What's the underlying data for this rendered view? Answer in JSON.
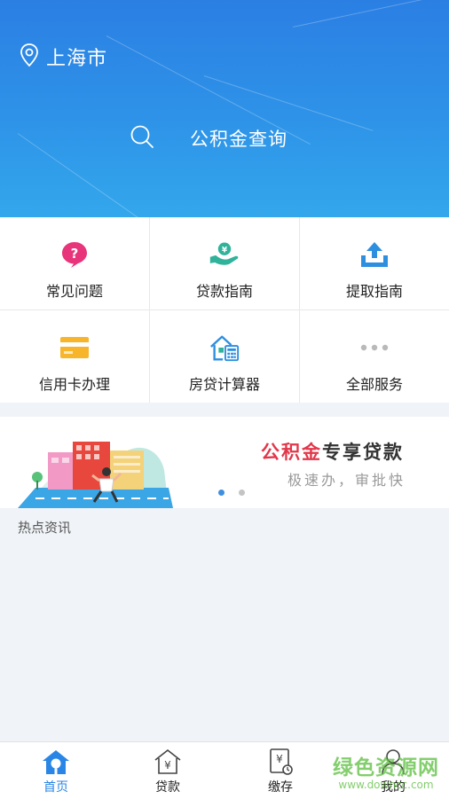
{
  "header": {
    "location": "上海市",
    "search_label": "公积金查询"
  },
  "services": [
    {
      "label": "常见问题",
      "icon": "question-bubble-icon"
    },
    {
      "label": "贷款指南",
      "icon": "money-hand-icon"
    },
    {
      "label": "提取指南",
      "icon": "upload-tray-icon"
    },
    {
      "label": "信用卡办理",
      "icon": "credit-card-icon"
    },
    {
      "label": "房贷计算器",
      "icon": "house-calculator-icon"
    },
    {
      "label": "全部服务",
      "icon": "more-dots-icon"
    }
  ],
  "banner": {
    "title_red": "公积金",
    "title_dark": "专享贷款",
    "subtitle": "极速办，审批快",
    "active_page": 1,
    "page_count": 2
  },
  "news": {
    "title": "热点资讯"
  },
  "tabs": [
    {
      "label": "首页",
      "icon": "home-icon",
      "active": true
    },
    {
      "label": "贷款",
      "icon": "loan-house-icon",
      "active": false
    },
    {
      "label": "缴存",
      "icon": "deposit-receipt-icon",
      "active": false
    },
    {
      "label": "我的",
      "icon": "user-icon",
      "active": false
    }
  ],
  "watermark": {
    "main": "绿色资源网",
    "url": "www.downcc.com"
  },
  "colors": {
    "accent": "#2a86e6",
    "header_top": "#2b7fe3",
    "header_bottom": "#33a7ec",
    "banner_red": "#e2374a",
    "icon_pink": "#e8347a",
    "icon_green": "#2fb39a",
    "icon_blue": "#2d8fe0",
    "icon_yellow": "#f7b52c"
  }
}
